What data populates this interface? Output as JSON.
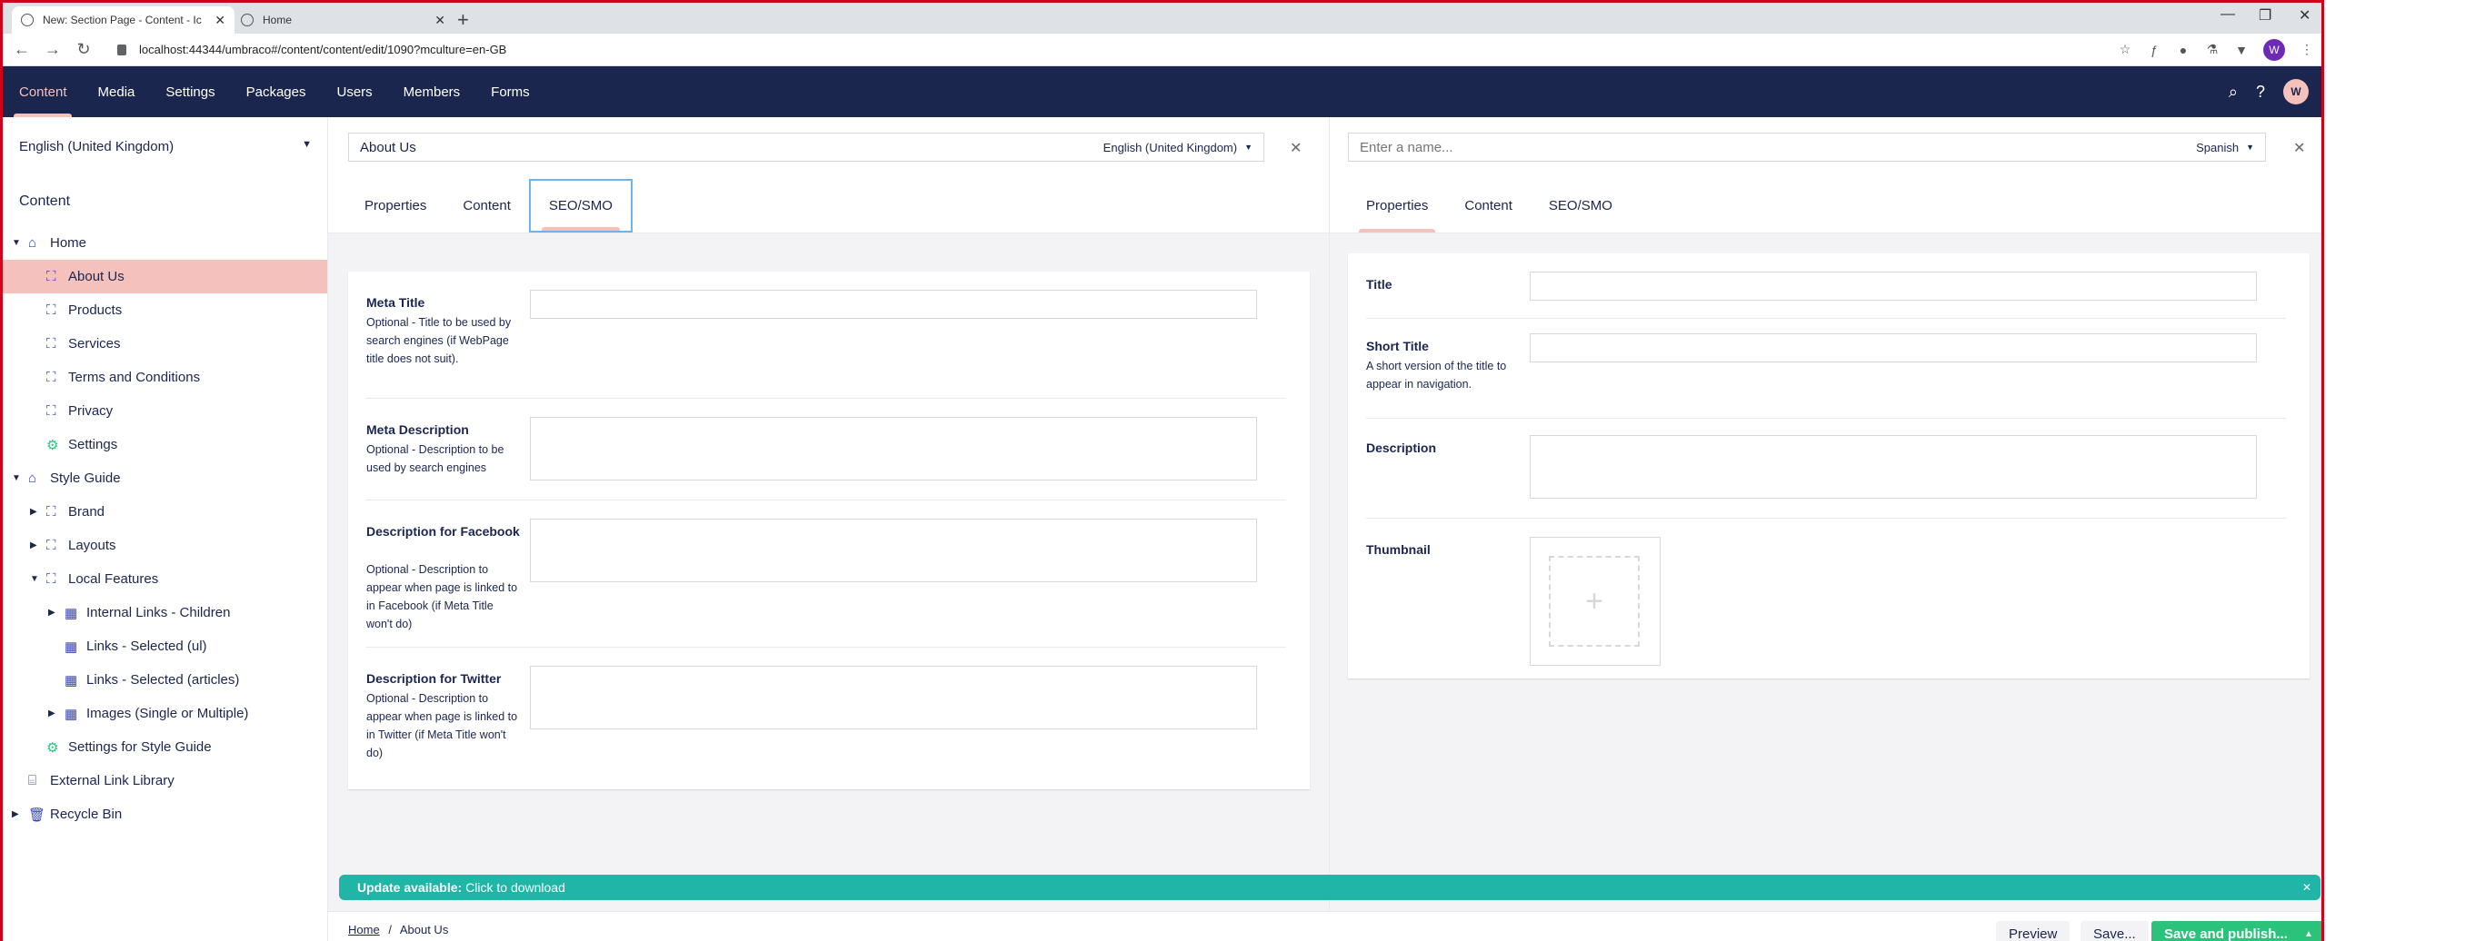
{
  "browser": {
    "tabs": [
      {
        "title": "New: Section Page - Content - Ic"
      },
      {
        "title": "Home"
      }
    ],
    "new_tab": "+",
    "url": "localhost:44344/umbraco#/content/content/edit/1090?mculture=en-GB",
    "profile_initial": "W"
  },
  "nav": {
    "items": [
      "Content",
      "Media",
      "Settings",
      "Packages",
      "Users",
      "Members",
      "Forms"
    ],
    "active": "Content",
    "avatar_initial": "W"
  },
  "sidebar": {
    "language": "English (United Kingdom)",
    "section_title": "Content",
    "tree": [
      {
        "label": "Home",
        "level": 0,
        "caret": "open",
        "icon": "home-icon"
      },
      {
        "label": "About Us",
        "level": 1,
        "caret": "none",
        "icon": "sitemap-icon",
        "selected": true
      },
      {
        "label": "Products",
        "level": 1,
        "caret": "none",
        "icon": "sitemap-icon"
      },
      {
        "label": "Services",
        "level": 1,
        "caret": "none",
        "icon": "sitemap-icon"
      },
      {
        "label": "Terms and Conditions",
        "level": 1,
        "caret": "none",
        "icon": "sitemap-icon"
      },
      {
        "label": "Privacy",
        "level": 1,
        "caret": "none",
        "icon": "sitemap-icon"
      },
      {
        "label": "Settings",
        "level": 1,
        "caret": "none",
        "icon": "gear-icon"
      },
      {
        "label": "Style Guide",
        "level": 0,
        "caret": "open",
        "icon": "home-icon"
      },
      {
        "label": "Brand",
        "level": 1,
        "caret": "closed",
        "icon": "sitemap-icon"
      },
      {
        "label": "Layouts",
        "level": 1,
        "caret": "closed",
        "icon": "sitemap-icon"
      },
      {
        "label": "Local Features",
        "level": 1,
        "caret": "open",
        "icon": "sitemap-icon"
      },
      {
        "label": "Internal Links - Children",
        "level": 2,
        "caret": "closed",
        "icon": "layout-icon"
      },
      {
        "label": "Links - Selected (ul)",
        "level": 2,
        "caret": "none",
        "icon": "layout-icon"
      },
      {
        "label": "Links - Selected (articles)",
        "level": 2,
        "caret": "none",
        "icon": "layout-icon"
      },
      {
        "label": "Images (Single or Multiple)",
        "level": 2,
        "caret": "closed",
        "icon": "layout-icon"
      },
      {
        "label": "Settings for Style Guide",
        "level": 1,
        "caret": "none",
        "icon": "gear-icon"
      },
      {
        "label": "External Link Library",
        "level": 0,
        "caret": "none",
        "icon": "library-icon"
      },
      {
        "label": "Recycle Bin",
        "level": 0,
        "caret": "closed",
        "icon": "trash-icon"
      }
    ]
  },
  "left_editor": {
    "name_value": "About Us",
    "language": "English (United Kingdom)",
    "tabs": [
      "Properties",
      "Content",
      "SEO/SMO"
    ],
    "active_tab": "SEO/SMO",
    "properties": [
      {
        "label": "Meta Title",
        "description": "Optional - Title to be used by search engines (if WebPage title does not suit)."
      },
      {
        "label": "Meta Description",
        "description": "Optional - Description to be used by search engines"
      },
      {
        "label": "Description for Facebook",
        "description": "Optional - Description to appear when page is linked to in Facebook (if Meta Title won't do)"
      },
      {
        "label": "Description for Twitter",
        "description": "Optional - Description to appear when page is linked to in Twitter (if Meta Title won't do)"
      }
    ]
  },
  "right_editor": {
    "name_placeholder": "Enter a name...",
    "language": "Spanish",
    "tabs": [
      "Properties",
      "Content",
      "SEO/SMO"
    ],
    "active_tab": "Properties",
    "properties": [
      {
        "label": "Title",
        "description": ""
      },
      {
        "label": "Short Title",
        "description": "A short version of the title to appear in navigation."
      },
      {
        "label": "Description",
        "description": ""
      },
      {
        "label": "Thumbnail",
        "description": ""
      }
    ]
  },
  "update": {
    "bold": "Update available:",
    "text": "Click to download"
  },
  "footer": {
    "breadcrumb": [
      "Home",
      "About Us"
    ],
    "separator": "/",
    "preview_label": "Preview",
    "save_label": "Save...",
    "publish_label": "Save and publish..."
  }
}
